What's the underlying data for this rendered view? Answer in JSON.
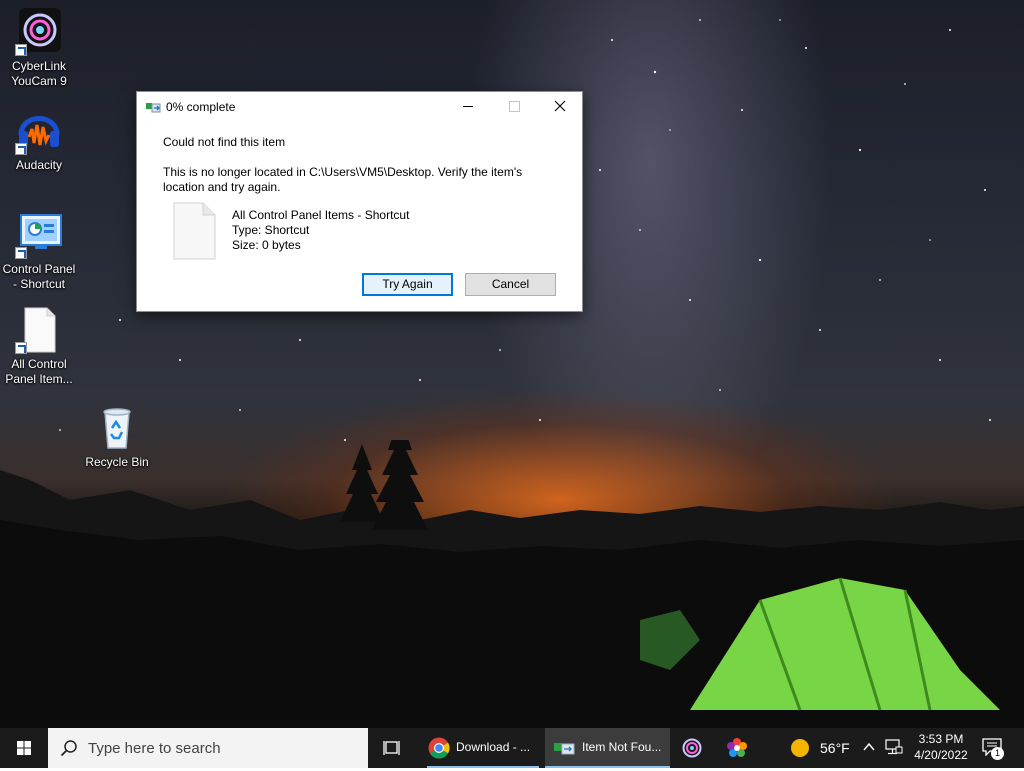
{
  "desktop": {
    "icons": [
      {
        "label": "CyberLink YouCam 9",
        "line1": "CyberLink",
        "line2": "YouCam 9"
      },
      {
        "label": "Audacity",
        "line1": "Audacity",
        "line2": ""
      },
      {
        "label": "Control Panel - Shortcut",
        "line1": "Control Panel",
        "line2": "- Shortcut"
      },
      {
        "label": "All Control Panel Items",
        "line1": "All Control",
        "line2": "Panel Item..."
      },
      {
        "label": "Recycle Bin",
        "line1": "Recycle Bin",
        "line2": ""
      }
    ]
  },
  "dialog": {
    "title": "0% complete",
    "heading": "Could not find this item",
    "message": "This is no longer located in C:\\Users\\VM5\\Desktop. Verify the item's location and try again.",
    "item_name": "All Control Panel Items - Shortcut",
    "item_type": "Type: Shortcut",
    "item_size": "Size: 0 bytes",
    "try_again_label": "Try Again",
    "cancel_label": "Cancel"
  },
  "taskbar": {
    "search_placeholder": "Type here to search",
    "apps": [
      {
        "label": "Download - ...",
        "icon": "chrome-icon"
      },
      {
        "label": "Item Not Fou...",
        "icon": "file-explorer-icon",
        "active": true
      }
    ],
    "weather_temp": "56°F",
    "time": "3:53 PM",
    "date": "4/20/2022",
    "notification_count": "1"
  },
  "colors": {
    "accent": "#0078d7",
    "taskbar_bg": "#1b1b1b",
    "tent_green": "#7ee04a"
  }
}
